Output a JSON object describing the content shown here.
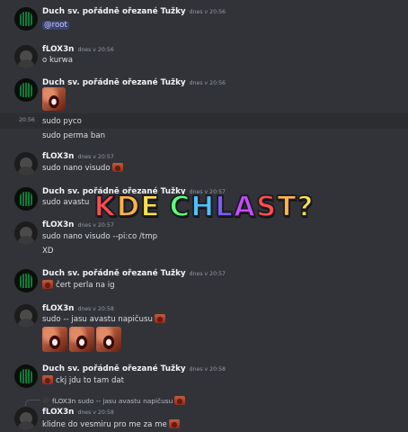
{
  "colors": {
    "background": "#313338",
    "mention_bg": "#3c4270",
    "username": "#f2f3f5",
    "timestamp": "#949ba4",
    "overlay_gradient": [
      "#ff4d4d",
      "#ffb347",
      "#ffe14d",
      "#5cff7a",
      "#4dc3ff",
      "#7a5cff",
      "#c44dff"
    ]
  },
  "messages": [
    {
      "author": "Duch sv. pořádně ořezané Tužky",
      "time": "dnes v 20:56",
      "lines": [
        "@root"
      ],
      "avatar": "avatar-duch"
    },
    {
      "author": "fLOX3n",
      "time": "dnes v 20:56",
      "lines": [
        "o kurwa"
      ],
      "avatar": "avatar-flox"
    },
    {
      "author": "Duch sv. pořádně ořezané Tužky",
      "time": "dnes v 20:56",
      "avatar": "avatar-duch",
      "sticker": "screaming-face-sticker"
    },
    {
      "side_time": "20:56",
      "lines": [
        "sudo pyco"
      ]
    },
    {
      "lines": [
        "sudo perma ban"
      ]
    },
    {
      "author": "fLOX3n",
      "time": "dnes v 20:57",
      "lines": [
        "sudo nano visudo"
      ],
      "avatar": "avatar-flox",
      "trailing_emoji": "screaming-face-emoji"
    },
    {
      "author": "Duch sv. pořádně ořezané Tužky",
      "time": "dnes v 20:57",
      "lines": [
        "sudo avastu"
      ],
      "avatar": "avatar-duch"
    },
    {
      "author": "fLOX3n",
      "time": "dnes v 20:57",
      "lines": [
        "sudo nano visudo --pi:co /tmp",
        "XD"
      ],
      "avatar": "avatar-flox"
    },
    {
      "author": "Duch sv. pořádně ořezané Tužky",
      "time": "dnes v 20:57",
      "lines": [
        "čert perla na ig"
      ],
      "avatar": "avatar-duch",
      "leading_emoji": "screaming-face-emoji"
    },
    {
      "author": "fLOX3n",
      "time": "dnes v 20:58",
      "lines": [
        "sudo -- jasu avastu napičusu"
      ],
      "avatar": "avatar-flox",
      "trailing_emoji": "screaming-face-emoji",
      "stickers": 3
    },
    {
      "author": "Duch sv. pořádně ořezané Tužky",
      "time": "dnes v 20:58",
      "lines": [
        "ckj jdu to tam dat"
      ],
      "avatar": "avatar-duch",
      "leading_emoji": "screaming-face-emoji"
    },
    {
      "reply_author": "fLOX3n",
      "reply_text": "sudo -- jasu avastu napičusu",
      "author": "fLOX3n",
      "time": "dnes v 20:58",
      "lines": [
        "klidne do vesmiru pro me za me"
      ],
      "avatar": "avatar-flox",
      "trailing_emoji": "screaming-face-emoji"
    }
  ],
  "overlay": {
    "text": "KDE CHLAST?"
  }
}
